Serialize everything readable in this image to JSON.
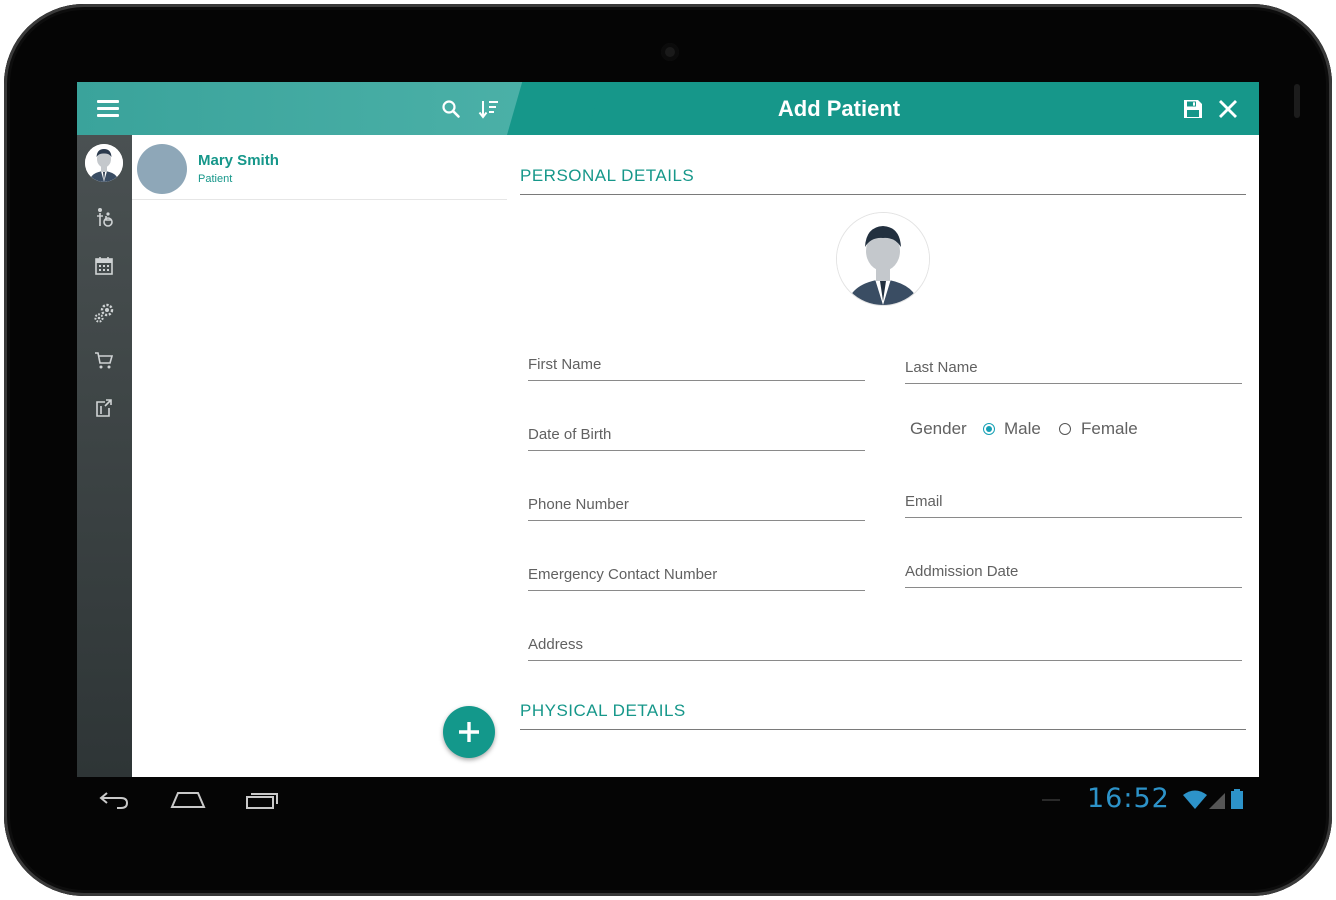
{
  "app": {
    "title": "Add Patient"
  },
  "toolbar": {
    "menu_icon": "menu-icon",
    "search_icon": "search-icon",
    "sort_icon": "sort-icon",
    "save_icon": "save-icon",
    "close_icon": "close-icon"
  },
  "rail": {
    "items": [
      {
        "icon": "profile-avatar-icon"
      },
      {
        "icon": "wheelchair-icon"
      },
      {
        "icon": "calendar-icon"
      },
      {
        "icon": "settings-gears-icon"
      },
      {
        "icon": "cart-icon"
      },
      {
        "icon": "logout-icon"
      }
    ]
  },
  "patient_list": {
    "items": [
      {
        "name": "Mary Smith",
        "role": "Patient"
      }
    ],
    "fab_icon": "plus-icon"
  },
  "form": {
    "sections": {
      "personal": "PERSONAL DETAILS",
      "physical": "PHYSICAL DETAILS"
    },
    "fields": {
      "first_name": "First Name",
      "last_name": "Last Name",
      "date_of_birth": "Date of Birth",
      "phone_number": "Phone Number",
      "email": "Email",
      "emergency_contact": "Emergency Contact Number",
      "admission_date": "Addmission Date",
      "address": "Address"
    },
    "gender": {
      "label": "Gender",
      "options": [
        "Male",
        "Female"
      ],
      "selected": "Male"
    }
  },
  "system_bar": {
    "time": "16:52",
    "icons": [
      "back-icon",
      "home-icon",
      "recent-apps-icon",
      "wifi-icon",
      "signal-icon",
      "battery-icon"
    ]
  },
  "colors": {
    "primary": "#16978a",
    "appbar_left": "#4cb1a8",
    "rail": "#3d4445",
    "radio_selected": "#16a0b5",
    "clock": "#2d93c9"
  }
}
